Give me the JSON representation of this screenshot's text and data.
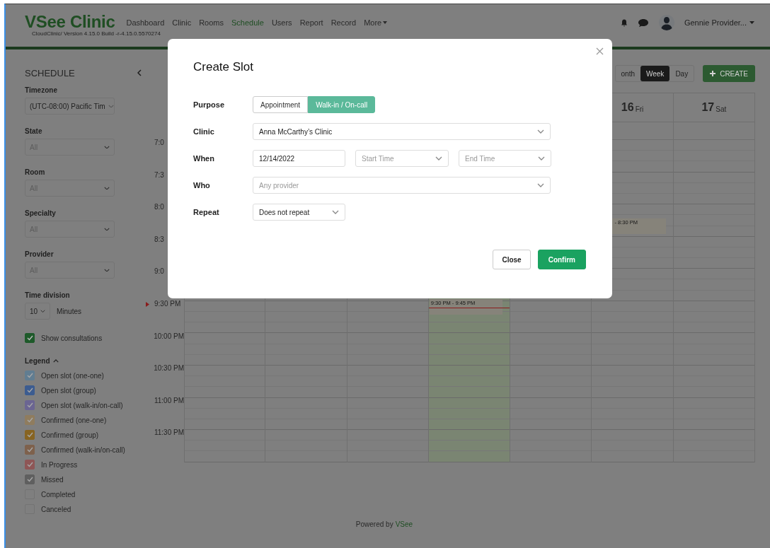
{
  "header": {
    "logo": "VSee Clinic",
    "version": "CloudClinic/ Version 4.15.0 Build -r-4.15.0.5570274",
    "nav": [
      {
        "label": "Dashboard",
        "selected": false
      },
      {
        "label": "Clinic",
        "selected": false
      },
      {
        "label": "Rooms",
        "selected": false
      },
      {
        "label": "Schedule",
        "selected": true
      },
      {
        "label": "Users",
        "selected": false
      },
      {
        "label": "Report",
        "selected": false
      },
      {
        "label": "Record",
        "selected": false
      },
      {
        "label": "More",
        "selected": false,
        "kind": "dropdown"
      }
    ],
    "user": "Gennie Provider..."
  },
  "sidebar": {
    "title": "SCHEDULE",
    "filters": [
      {
        "label": "Timezone",
        "value": "(UTC-08:00) Pacific Tim",
        "disabled": false
      },
      {
        "label": "State",
        "value": "All",
        "disabled": true
      },
      {
        "label": "Room",
        "value": "All",
        "disabled": true
      },
      {
        "label": "Specialty",
        "value": "All",
        "disabled": true
      },
      {
        "label": "Provider",
        "value": "All",
        "disabled": true
      }
    ],
    "time_division": {
      "label": "Time division",
      "value": "10",
      "unit": "Minutes"
    },
    "show_consultations": {
      "label": "Show consultations",
      "checked": true
    },
    "legend": {
      "title": "Legend",
      "expanded": true,
      "items": [
        {
          "label": "Open slot (one-one)",
          "color": "#617d91",
          "checked": true
        },
        {
          "label": "Open slot (group)",
          "color": "#3c5c90",
          "checked": true
        },
        {
          "label": "Open slot (walk-in/on-call)",
          "color": "#6b6592",
          "checked": true
        },
        {
          "label": "Confirmed (one-one)",
          "color": "#8f7c5e",
          "checked": true
        },
        {
          "label": "Confirmed (group)",
          "color": "#876422",
          "checked": true
        },
        {
          "label": "Confirmed (walk-in/on-call)",
          "color": "#7e614c",
          "checked": true
        },
        {
          "label": "In Progress",
          "color": "#8e5656",
          "checked": true
        },
        {
          "label": "Missed",
          "color": "#5f5f5f",
          "checked": true
        },
        {
          "label": "Completed",
          "checked": false
        },
        {
          "label": "Canceled",
          "checked": false
        }
      ]
    }
  },
  "calendar": {
    "views": [
      {
        "label": "onth",
        "selected": false
      },
      {
        "label": "Week",
        "selected": true
      },
      {
        "label": "Day",
        "selected": false
      }
    ],
    "create": "CREATE",
    "times": [
      {
        "label": "7:0",
        "current": false
      },
      {
        "label": "7:3",
        "current": false
      },
      {
        "label": "8:0",
        "current": false
      },
      {
        "label": "8:3",
        "current": false
      },
      {
        "label": "9:0",
        "current": false
      },
      {
        "label": "9:30 PM",
        "current": true
      },
      {
        "label": "10:00 PM",
        "current": false
      },
      {
        "label": "10:30 PM",
        "current": false
      },
      {
        "label": "11:00 PM",
        "current": false
      },
      {
        "label": "11:30 PM",
        "current": false
      }
    ],
    "columns": [
      {
        "today": false
      },
      {
        "today": false
      },
      {
        "today": false
      },
      {
        "today": true,
        "events": [
          {
            "time": "9:30 PM - 9:45 PM"
          }
        ]
      },
      {
        "today": false
      },
      {
        "today": false,
        "day": "16",
        "weekday": "Fri",
        "events": [
          {
            "time": "- 8:30 PM"
          }
        ]
      },
      {
        "today": false,
        "day": "17",
        "weekday": "Sat"
      }
    ]
  },
  "footer": {
    "text": "Powered by",
    "link": "VSee"
  },
  "modal": {
    "title": "Create Slot",
    "purpose": {
      "label": "Purpose",
      "options": [
        {
          "label": "Appointment",
          "selected": false
        },
        {
          "label": "Walk-in / On-call",
          "selected": true
        }
      ]
    },
    "clinic": {
      "label": "Clinic",
      "value": "Anna McCarthy’s Clinic"
    },
    "when": {
      "label": "When",
      "date": "12/14/2022",
      "start_placeholder": "Start Time",
      "end_placeholder": "End Time"
    },
    "who": {
      "label": "Who",
      "placeholder": "Any provider"
    },
    "repeat": {
      "label": "Repeat",
      "value": "Does not repeat"
    },
    "buttons": [
      {
        "label": "Close",
        "kind": "secondary"
      },
      {
        "label": "Confirm",
        "kind": "primary"
      }
    ]
  }
}
